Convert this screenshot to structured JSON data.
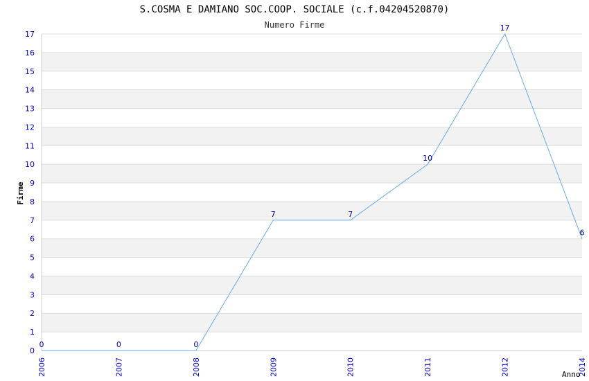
{
  "chart_data": {
    "type": "line",
    "title": "S.COSMA E DAMIANO SOC.COOP. SOCIALE (c.f.04204520870)",
    "subtitle": "Numero Firme",
    "xlabel": "Anno",
    "ylabel": "Firme",
    "x": [
      "2006",
      "2007",
      "2008",
      "2009",
      "2010",
      "2011",
      "2012",
      "2014"
    ],
    "values": [
      0,
      0,
      0,
      7,
      7,
      10,
      17,
      6
    ],
    "data_labels": [
      "0",
      "0",
      "0",
      "7",
      "7",
      "10",
      "17",
      "6"
    ],
    "ylim": [
      0,
      17
    ],
    "y_ticks": [
      "0",
      "1",
      "2",
      "3",
      "4",
      "5",
      "6",
      "7",
      "8",
      "9",
      "10",
      "11",
      "12",
      "13",
      "14",
      "15",
      "16",
      "17"
    ],
    "grid": "horizontal alternating bands",
    "colors": {
      "line": "#6aa9ea",
      "tick_text": "#0000cc",
      "label_text": "#000099",
      "band": "#f2f2f2",
      "grid_line": "#dddddd"
    }
  }
}
